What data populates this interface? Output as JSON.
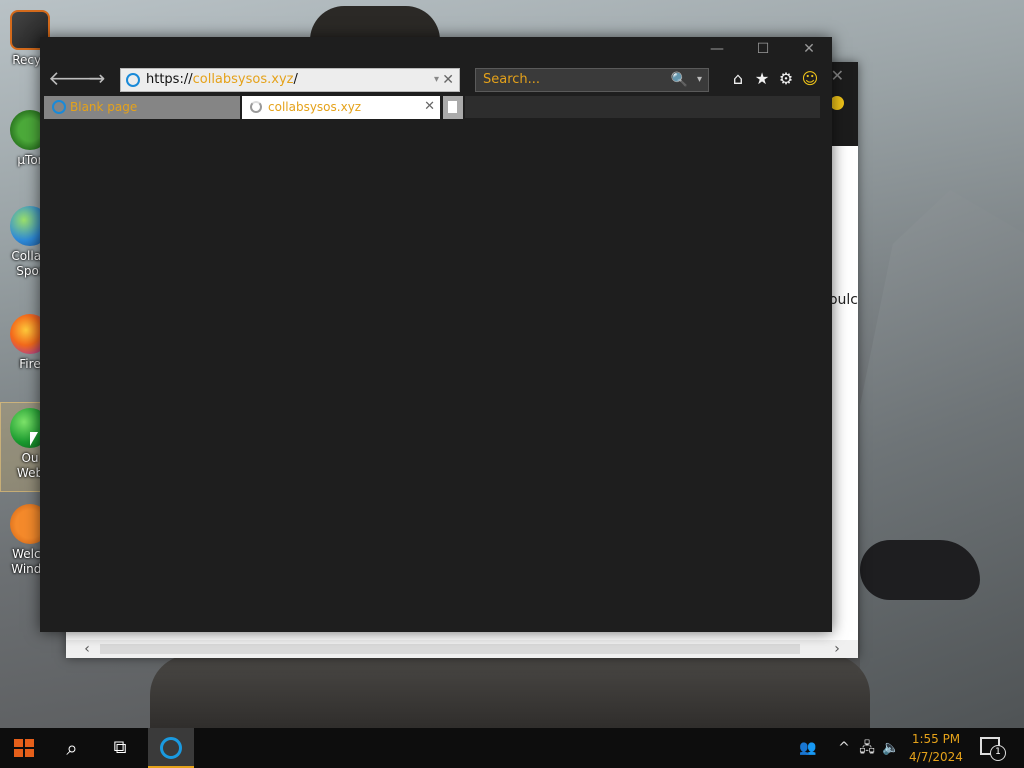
{
  "desktop": {
    "icons": [
      {
        "label": "Recyc",
        "icon": "recycle-bin-icon"
      },
      {
        "label": "µTor",
        "icon": "utorrent-icon"
      },
      {
        "label": "Collab\nSpor",
        "icon": "collab-globe-icon"
      },
      {
        "label": "Fire",
        "icon": "firefox-icon"
      },
      {
        "label": "Ou\nWeb",
        "icon": "web-globe-icon"
      },
      {
        "label": "Welco\nWindo",
        "icon": "welcome-icon"
      }
    ]
  },
  "background_window": {
    "close_glyph": "✕",
    "partial_text": "houlc",
    "scroll_left": "‹",
    "scroll_right": "›"
  },
  "browser": {
    "window_controls": {
      "minimize": "—",
      "maximize": "☐",
      "close": "✕"
    },
    "nav": {
      "back": "🡐",
      "forward": "→"
    },
    "address": {
      "protocol": "https://",
      "domain": "collabsysos.xyz",
      "path": "/",
      "dropdown": "▾",
      "clear": "✕"
    },
    "search": {
      "placeholder": "Search...",
      "icon": "🔍",
      "dropdown": "▾"
    },
    "toolbar": {
      "home": "⌂",
      "favorites": "★",
      "settings": "⚙",
      "feedback": "☺"
    },
    "tabs": [
      {
        "label": "Blank page",
        "state": "inactive"
      },
      {
        "label": "collabsysos.xyz",
        "state": "active-loading",
        "close": "✕"
      }
    ],
    "accent_color": "#e5a21a"
  },
  "taskbar": {
    "search_icon": "⌕",
    "task_view_icon": "⧉",
    "tray": {
      "people": "👥",
      "chevron": "^",
      "network": "🖧",
      "volume": "🔈"
    },
    "clock": {
      "time": "1:55 PM",
      "date": "4/7/2024"
    },
    "notifications_count": "1"
  }
}
